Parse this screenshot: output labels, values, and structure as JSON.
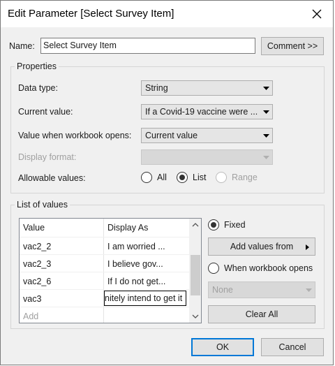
{
  "window": {
    "title": "Edit Parameter [Select Survey Item]",
    "close_icon": "close-icon"
  },
  "name_row": {
    "label": "Name:",
    "value": "Select Survey Item",
    "comment_button": "Comment >>"
  },
  "properties": {
    "title": "Properties",
    "data_type_label": "Data type:",
    "data_type_value": "String",
    "current_value_label": "Current value:",
    "current_value_value": "If a Covid-19 vaccine were ...",
    "workbook_opens_label": "Value when workbook opens:",
    "workbook_opens_value": "Current value",
    "display_format_label": "Display format:",
    "display_format_value": "",
    "allowable_label": "Allowable values:",
    "allowable_options": [
      {
        "label": "All",
        "selected": false,
        "enabled": true
      },
      {
        "label": "List",
        "selected": true,
        "enabled": true
      },
      {
        "label": "Range",
        "selected": false,
        "enabled": false
      }
    ]
  },
  "list_of_values": {
    "title": "List of values",
    "columns": [
      "Value",
      "Display As"
    ],
    "rows": [
      {
        "value": "vac2_2",
        "display": "I am worried ..."
      },
      {
        "value": "vac2_3",
        "display": "I believe gov..."
      },
      {
        "value": "vac2_6",
        "display": "If I do not get..."
      },
      {
        "value": "vac3",
        "display": "nitely intend to get it"
      }
    ],
    "add_placeholder": "Add",
    "fixed_label": "Fixed",
    "add_values_from": "Add values from",
    "when_workbook_opens_label": "When workbook opens",
    "none_value": "None",
    "clear_all": "Clear All"
  },
  "footer": {
    "ok": "OK",
    "cancel": "Cancel"
  },
  "colors": {
    "accent": "#0078d7",
    "dialog_bg": "#f0f0f0"
  }
}
